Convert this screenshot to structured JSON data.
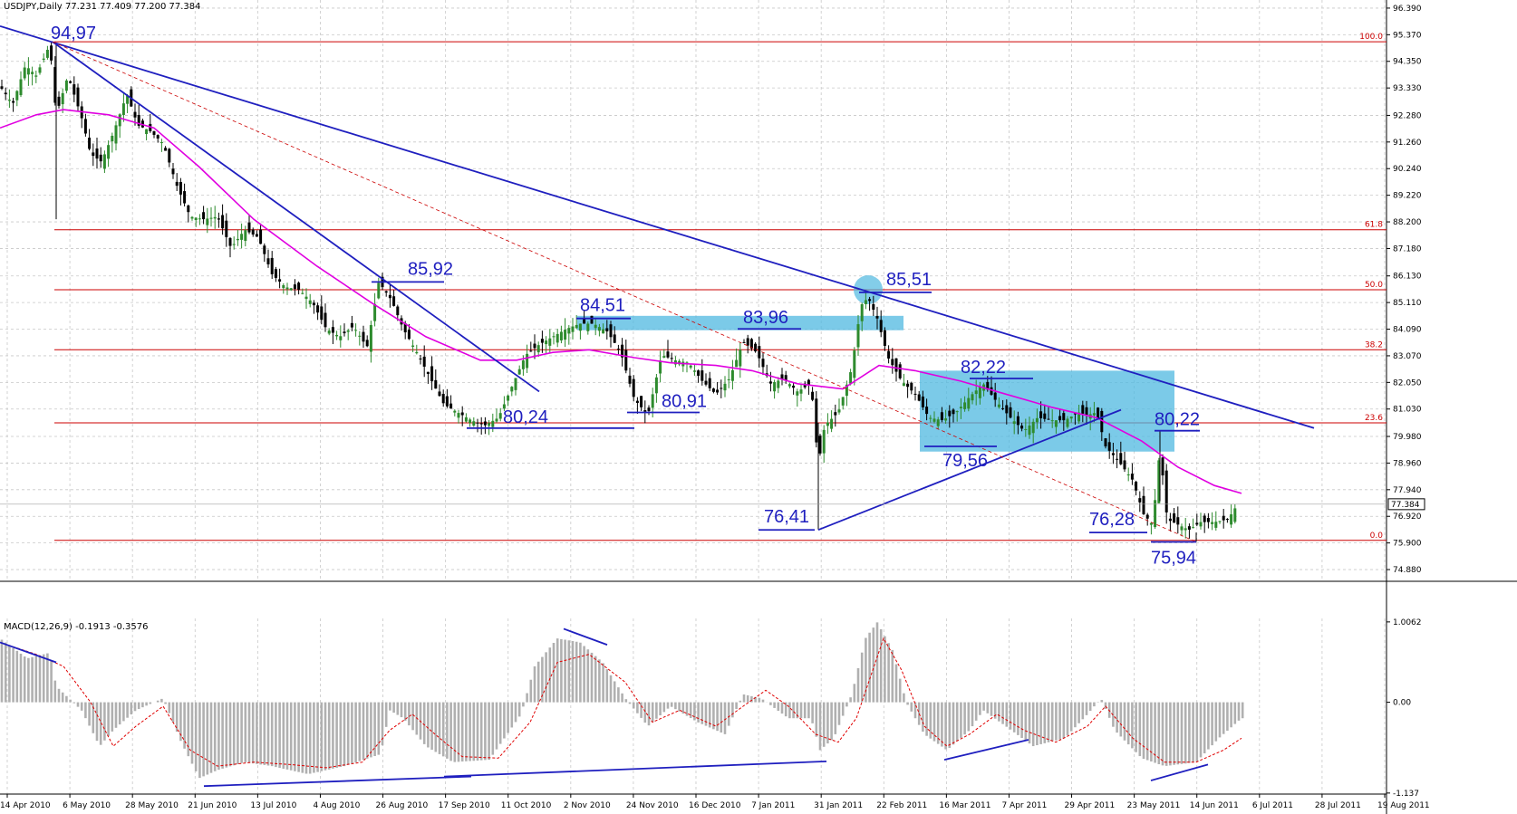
{
  "chart_header": {
    "symbol_label": "USDJPY,Daily",
    "ohlc_label": "77.231 77.409 77.200 77.384"
  },
  "macd_header": {
    "label": "MACD(12,26,9) -0.1913 -0.3576"
  },
  "colors": {
    "bull_candle": "#2e8b2e",
    "bear_candle": "#000000",
    "moving_average": "#e000e0",
    "trendline": "#1f1fbf",
    "fib_line": "#cc0000",
    "zone_fill": "#4fb8e0",
    "macd_hist": "#b0b0b0",
    "macd_signal": "#e00000",
    "grid": "#c8c8c8"
  },
  "chart_data": [
    {
      "type": "candlestick",
      "title": "USDJPY,Daily",
      "ylim": [
        74.5,
        96.7
      ],
      "y_ticks": [
        "96.390",
        "95.370",
        "94.350",
        "93.330",
        "92.280",
        "91.260",
        "90.240",
        "89.220",
        "88.200",
        "87.180",
        "86.130",
        "85.110",
        "84.090",
        "83.070",
        "82.050",
        "81.030",
        "79.980",
        "78.960",
        "77.940",
        "76.920",
        "75.900",
        "74.880"
      ],
      "current_price": "77.384",
      "x_ticks": [
        "14 Apr 2010",
        "6 May 2010",
        "28 May 2010",
        "21 Jun 2010",
        "13 Jul 2010",
        "4 Aug 2010",
        "26 Aug 2010",
        "17 Sep 2010",
        "11 Oct 2010",
        "2 Nov 2010",
        "24 Nov 2010",
        "16 Dec 2010",
        "7 Jan 2011",
        "31 Jan 2011",
        "22 Feb 2011",
        "16 Mar 2011",
        "7 Apr 2011",
        "29 Apr 2011",
        "23 May 2011",
        "14 Jun 2011",
        "6 Jul 2011",
        "28 Jul 2011",
        "19 Aug 2011"
      ],
      "close_path": [
        [
          0,
          93.4
        ],
        [
          14,
          92.7
        ],
        [
          28,
          94.2
        ],
        [
          40,
          93.8
        ],
        [
          55,
          95.0
        ],
        [
          62,
          92.3
        ],
        [
          75,
          93.8
        ],
        [
          90,
          92.2
        ],
        [
          100,
          90.8
        ],
        [
          112,
          90.5
        ],
        [
          125,
          91.6
        ],
        [
          140,
          93.1
        ],
        [
          152,
          91.9
        ],
        [
          165,
          91.7
        ],
        [
          180,
          91.2
        ],
        [
          195,
          89.6
        ],
        [
          210,
          88.4
        ],
        [
          225,
          88.3
        ],
        [
          240,
          88.4
        ],
        [
          255,
          87.2
        ],
        [
          270,
          87.9
        ],
        [
          285,
          87.6
        ],
        [
          300,
          86.2
        ],
        [
          315,
          85.7
        ],
        [
          330,
          85.6
        ],
        [
          345,
          85.1
        ],
        [
          360,
          84.1
        ],
        [
          375,
          83.8
        ],
        [
          390,
          84.2
        ],
        [
          405,
          83.4
        ],
        [
          418,
          85.9
        ],
        [
          432,
          85.2
        ],
        [
          445,
          84.1
        ],
        [
          460,
          83.2
        ],
        [
          475,
          82.2
        ],
        [
          490,
          81.2
        ],
        [
          505,
          80.9
        ],
        [
          520,
          80.6
        ],
        [
          535,
          80.4
        ],
        [
          550,
          80.7
        ],
        [
          565,
          81.9
        ],
        [
          580,
          83.1
        ],
        [
          595,
          83.5
        ],
        [
          610,
          83.8
        ],
        [
          625,
          84.1
        ],
        [
          640,
          84.3
        ],
        [
          655,
          84.3
        ],
        [
          670,
          84.0
        ],
        [
          685,
          83.2
        ],
        [
          700,
          81.4
        ],
        [
          715,
          80.8
        ],
        [
          730,
          83.1
        ],
        [
          745,
          82.9
        ],
        [
          760,
          82.8
        ],
        [
          775,
          82.1
        ],
        [
          790,
          81.6
        ],
        [
          805,
          82.2
        ],
        [
          820,
          83.6
        ],
        [
          835,
          83.2
        ],
        [
          850,
          82.0
        ],
        [
          865,
          82.2
        ],
        [
          880,
          81.7
        ],
        [
          895,
          82.0
        ],
        [
          903,
          78.9
        ],
        [
          910,
          80.4
        ],
        [
          925,
          80.9
        ],
        [
          940,
          82.6
        ],
        [
          950,
          85.0
        ],
        [
          958,
          85.3
        ],
        [
          968,
          84.5
        ],
        [
          980,
          83.0
        ],
        [
          995,
          82.1
        ],
        [
          1010,
          81.6
        ],
        [
          1025,
          80.7
        ],
        [
          1040,
          80.6
        ],
        [
          1055,
          80.9
        ],
        [
          1070,
          81.5
        ],
        [
          1085,
          82.0
        ],
        [
          1100,
          81.3
        ],
        [
          1115,
          80.7
        ],
        [
          1130,
          80.2
        ],
        [
          1145,
          80.7
        ],
        [
          1160,
          80.6
        ],
        [
          1175,
          80.6
        ],
        [
          1190,
          80.9
        ],
        [
          1200,
          80.8
        ],
        [
          1210,
          80.9
        ],
        [
          1220,
          79.6
        ],
        [
          1235,
          79.0
        ],
        [
          1250,
          78.3
        ],
        [
          1262,
          77.0
        ],
        [
          1272,
          76.6
        ],
        [
          1280,
          79.5
        ],
        [
          1288,
          76.8
        ],
        [
          1300,
          76.6
        ],
        [
          1312,
          76.4
        ],
        [
          1325,
          76.7
        ],
        [
          1340,
          76.7
        ],
        [
          1355,
          76.8
        ],
        [
          1366,
          77.4
        ]
      ],
      "moving_average": [
        [
          0,
          91.8
        ],
        [
          40,
          92.3
        ],
        [
          70,
          92.5
        ],
        [
          120,
          92.3
        ],
        [
          170,
          91.8
        ],
        [
          220,
          90.3
        ],
        [
          280,
          88.3
        ],
        [
          350,
          86.5
        ],
        [
          410,
          85.1
        ],
        [
          470,
          83.8
        ],
        [
          530,
          82.9
        ],
        [
          570,
          82.9
        ],
        [
          610,
          83.2
        ],
        [
          650,
          83.3
        ],
        [
          700,
          83.0
        ],
        [
          740,
          82.8
        ],
        [
          790,
          82.7
        ],
        [
          830,
          82.5
        ],
        [
          880,
          82.0
        ],
        [
          930,
          81.8
        ],
        [
          970,
          82.7
        ],
        [
          1010,
          82.5
        ],
        [
          1060,
          82.1
        ],
        [
          1110,
          81.6
        ],
        [
          1160,
          81.1
        ],
        [
          1210,
          80.7
        ],
        [
          1260,
          79.8
        ],
        [
          1300,
          78.8
        ],
        [
          1340,
          78.1
        ],
        [
          1370,
          77.8
        ]
      ],
      "fibonacci_levels": [
        {
          "label": "100.0",
          "price": 95.1
        },
        {
          "label": "61.8",
          "price": 87.9
        },
        {
          "label": "50.0",
          "price": 85.6
        },
        {
          "label": "38.2",
          "price": 83.3
        },
        {
          "label": "23.6",
          "price": 80.5
        },
        {
          "label": "0.0",
          "price": 76.0
        }
      ],
      "annotations": [
        {
          "text": "94,97",
          "x": 58,
          "price": 95.0
        },
        {
          "text": "85,92",
          "x": 420,
          "price": 85.9
        },
        {
          "text": "84,51",
          "x": 640,
          "price": 84.5
        },
        {
          "text": "83,96",
          "x": 820,
          "price": 84.1
        },
        {
          "text": "85,51",
          "x": 958,
          "price": 85.5
        },
        {
          "text": "82,22",
          "x": 1080,
          "price": 82.2
        },
        {
          "text": "80,24",
          "x": 535,
          "price": 80.3
        },
        {
          "text": "80,91",
          "x": 700,
          "price": 80.9
        },
        {
          "text": "79,56",
          "x": 1040,
          "price": 79.6
        },
        {
          "text": "76,41",
          "x": 903,
          "price": 76.4
        },
        {
          "text": "80,22",
          "x": 1280,
          "price": 80.2
        },
        {
          "text": "76,28",
          "x": 1262,
          "price": 76.3
        },
        {
          "text": "75,94",
          "x": 1320,
          "price": 75.94
        }
      ],
      "trendlines": [
        {
          "x1": 0,
          "p1": 95.7,
          "x2": 1450,
          "p2": 80.3
        },
        {
          "x1": 58,
          "p1": 95.1,
          "x2": 595,
          "p2": 81.7
        },
        {
          "x1": 903,
          "p1": 76.4,
          "x2": 1237,
          "p2": 81.0
        }
      ],
      "zones": [
        {
          "x1": 637,
          "p1": 84.6,
          "x2": 997,
          "p2": 84.05
        },
        {
          "x1": 1015,
          "p1": 82.5,
          "x2": 1296,
          "p2": 79.4
        }
      ],
      "highlight_circle": {
        "x": 958,
        "price": 85.6
      }
    },
    {
      "type": "bar",
      "title": "MACD(12,26,9)",
      "ylim": [
        -1.15,
        1.05
      ],
      "y_ticks": [
        "1.0062",
        "0.00",
        "-1.137"
      ],
      "histogram_path": [
        [
          0,
          0.8
        ],
        [
          30,
          0.55
        ],
        [
          55,
          0.62
        ],
        [
          62,
          0.2
        ],
        [
          90,
          -0.1
        ],
        [
          110,
          -0.55
        ],
        [
          125,
          -0.35
        ],
        [
          150,
          -0.1
        ],
        [
          180,
          0.05
        ],
        [
          200,
          -0.5
        ],
        [
          220,
          -0.95
        ],
        [
          240,
          -0.85
        ],
        [
          270,
          -0.75
        ],
        [
          300,
          -0.8
        ],
        [
          340,
          -0.9
        ],
        [
          380,
          -0.8
        ],
        [
          420,
          -0.65
        ],
        [
          430,
          -0.1
        ],
        [
          445,
          -0.2
        ],
        [
          470,
          -0.55
        ],
        [
          500,
          -0.75
        ],
        [
          540,
          -0.72
        ],
        [
          575,
          -0.15
        ],
        [
          590,
          0.45
        ],
        [
          615,
          0.8
        ],
        [
          640,
          0.75
        ],
        [
          665,
          0.5
        ],
        [
          690,
          0.05
        ],
        [
          715,
          -0.3
        ],
        [
          740,
          -0.05
        ],
        [
          770,
          -0.25
        ],
        [
          800,
          -0.4
        ],
        [
          820,
          0.1
        ],
        [
          840,
          0.05
        ],
        [
          870,
          -0.2
        ],
        [
          895,
          -0.2
        ],
        [
          905,
          -0.6
        ],
        [
          920,
          -0.45
        ],
        [
          940,
          0.1
        ],
        [
          955,
          0.8
        ],
        [
          968,
          1.0
        ],
        [
          985,
          0.65
        ],
        [
          1000,
          0.0
        ],
        [
          1020,
          -0.4
        ],
        [
          1045,
          -0.6
        ],
        [
          1070,
          -0.35
        ],
        [
          1085,
          -0.1
        ],
        [
          1110,
          -0.3
        ],
        [
          1140,
          -0.55
        ],
        [
          1175,
          -0.45
        ],
        [
          1200,
          -0.15
        ],
        [
          1215,
          0.05
        ],
        [
          1230,
          -0.35
        ],
        [
          1260,
          -0.7
        ],
        [
          1285,
          -0.8
        ],
        [
          1320,
          -0.75
        ],
        [
          1345,
          -0.45
        ],
        [
          1370,
          -0.2
        ]
      ],
      "signal_path": [
        [
          0,
          0.75
        ],
        [
          40,
          0.6
        ],
        [
          70,
          0.45
        ],
        [
          100,
          0.0
        ],
        [
          125,
          -0.55
        ],
        [
          150,
          -0.3
        ],
        [
          180,
          -0.05
        ],
        [
          210,
          -0.6
        ],
        [
          240,
          -0.8
        ],
        [
          280,
          -0.75
        ],
        [
          320,
          -0.78
        ],
        [
          360,
          -0.82
        ],
        [
          400,
          -0.75
        ],
        [
          430,
          -0.35
        ],
        [
          455,
          -0.15
        ],
        [
          480,
          -0.4
        ],
        [
          510,
          -0.68
        ],
        [
          550,
          -0.7
        ],
        [
          585,
          -0.25
        ],
        [
          615,
          0.5
        ],
        [
          650,
          0.6
        ],
        [
          690,
          0.25
        ],
        [
          720,
          -0.25
        ],
        [
          750,
          -0.1
        ],
        [
          790,
          -0.3
        ],
        [
          820,
          -0.05
        ],
        [
          845,
          0.15
        ],
        [
          870,
          -0.05
        ],
        [
          900,
          -0.4
        ],
        [
          925,
          -0.5
        ],
        [
          945,
          -0.2
        ],
        [
          975,
          0.8
        ],
        [
          995,
          0.4
        ],
        [
          1020,
          -0.3
        ],
        [
          1045,
          -0.55
        ],
        [
          1070,
          -0.4
        ],
        [
          1100,
          -0.15
        ],
        [
          1130,
          -0.35
        ],
        [
          1165,
          -0.5
        ],
        [
          1200,
          -0.3
        ],
        [
          1220,
          -0.05
        ],
        [
          1250,
          -0.45
        ],
        [
          1285,
          -0.75
        ],
        [
          1320,
          -0.75
        ],
        [
          1350,
          -0.6
        ],
        [
          1370,
          -0.45
        ]
      ],
      "trendlines": [
        {
          "x1": 0,
          "v1": 0.75,
          "x2": 62,
          "v2": 0.5
        },
        {
          "x1": 225,
          "v1": -1.05,
          "x2": 520,
          "v2": -0.93
        },
        {
          "x1": 490,
          "v1": -0.93,
          "x2": 912,
          "v2": -0.74
        },
        {
          "x1": 622,
          "v1": 0.92,
          "x2": 670,
          "v2": 0.72
        },
        {
          "x1": 1042,
          "v1": -0.72,
          "x2": 1135,
          "v2": -0.47
        },
        {
          "x1": 1270,
          "v1": -0.98,
          "x2": 1333,
          "v2": -0.78
        }
      ]
    }
  ]
}
